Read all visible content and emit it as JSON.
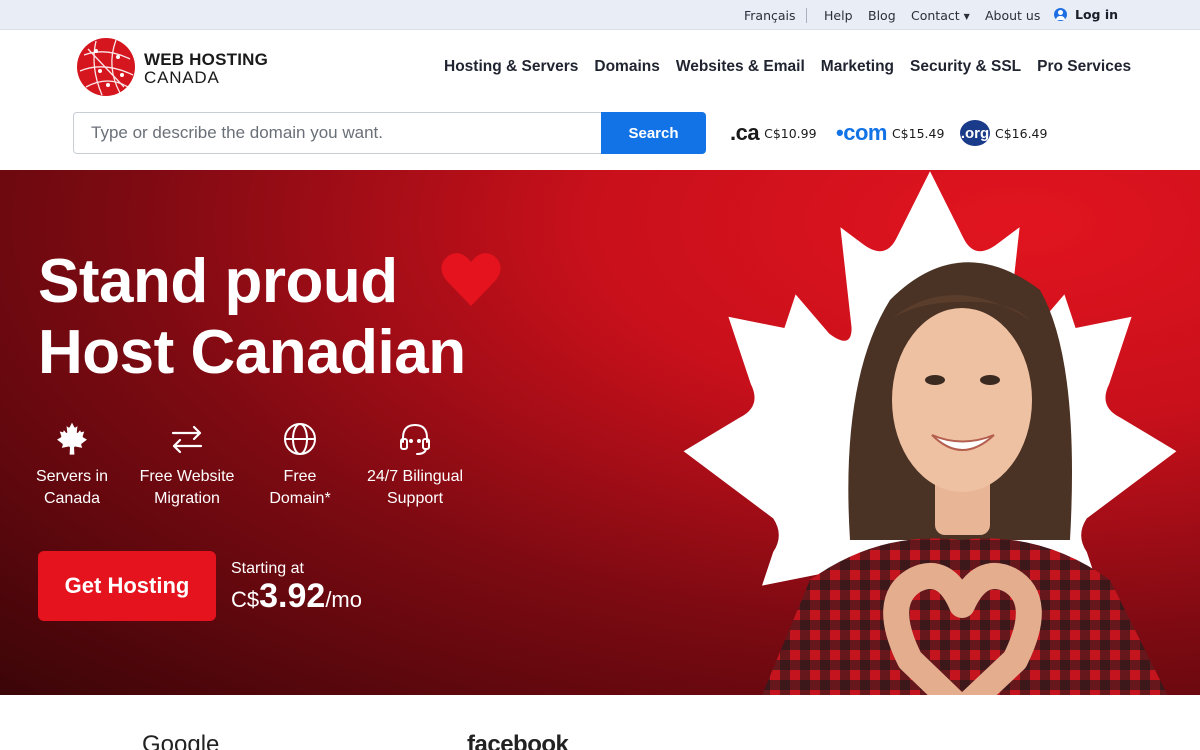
{
  "topbar": {
    "lang": "Français",
    "help": "Help",
    "blog": "Blog",
    "contact": "Contact",
    "about": "About us",
    "login": "Log in"
  },
  "logo": {
    "line1": "WEB HOSTING",
    "line2": "CANADA"
  },
  "nav": [
    "Hosting & Servers",
    "Domains",
    "Websites & Email",
    "Marketing",
    "Security & SSL",
    "Pro Services"
  ],
  "search": {
    "placeholder": "Type or describe the domain you want.",
    "button": "Search"
  },
  "tlds": [
    {
      "name": ".ca",
      "price": "C$10.99"
    },
    {
      "name": "•com",
      "price": "C$15.49"
    },
    {
      "name": ".org",
      "price": "C$16.49"
    }
  ],
  "hero": {
    "title_line1": "Stand proud",
    "title_line2": "Host Canadian",
    "features": [
      {
        "line1": "Servers in",
        "line2": "Canada",
        "icon": "maple-leaf-icon"
      },
      {
        "line1": "Free Website",
        "line2": "Migration",
        "icon": "transfer-arrows-icon"
      },
      {
        "line1": "Free",
        "line2": "Domain*",
        "icon": "globe-icon"
      },
      {
        "line1": "24/7 Bilingual",
        "line2": "Support",
        "icon": "headset-icon"
      }
    ],
    "cta": "Get Hosting",
    "starting_label": "Starting at",
    "price_currency": "C$",
    "price_amount": "3.92",
    "price_period": "/mo"
  },
  "partner_logos": [
    "Google",
    "facebook"
  ],
  "colors": {
    "accent_red": "#e5131d",
    "brand_blue": "#1273e6",
    "topbar_bg": "#e9edf5"
  }
}
